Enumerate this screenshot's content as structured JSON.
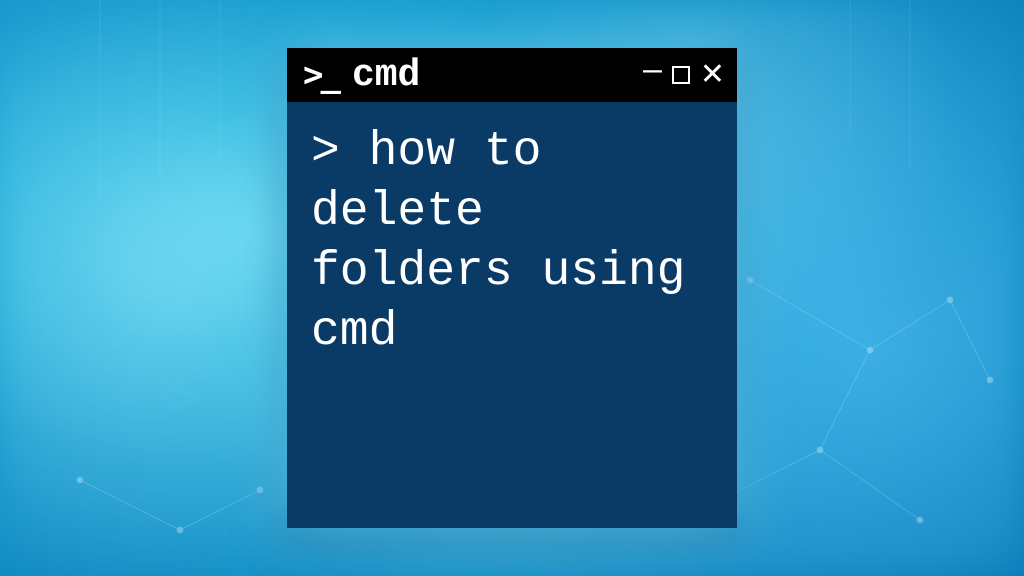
{
  "window": {
    "prompt_icon": ">_",
    "title": "cmd"
  },
  "terminal": {
    "text": "> how to delete folders using cmd"
  },
  "colors": {
    "title_bar_bg": "#000000",
    "terminal_bg": "#0a3a66",
    "text": "#ffffff"
  }
}
